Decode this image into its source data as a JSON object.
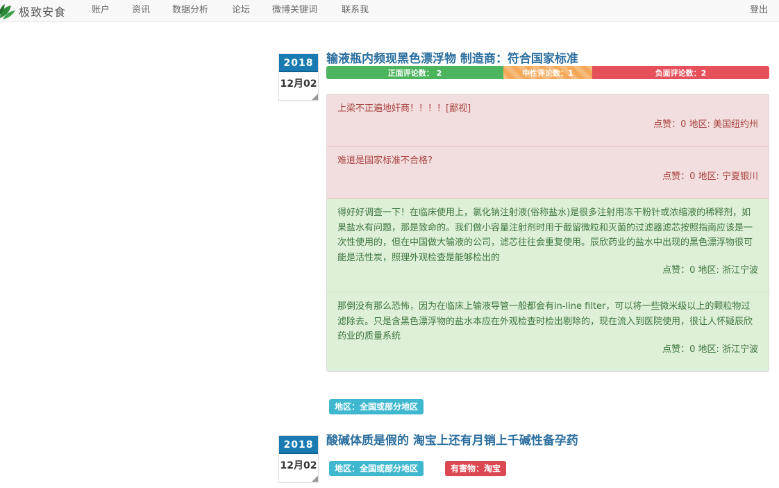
{
  "nav": {
    "brand": "极致安食",
    "items": [
      "账户",
      "资讯",
      "数据分析",
      "论坛",
      "微博关键词",
      "联系我"
    ],
    "logout": "登出"
  },
  "colors": {
    "positive": "#4cb45d",
    "neutral": "#f4a95a",
    "negative": "#e5505a",
    "info_label": "#3fb8cf",
    "danger_label": "#dc4852",
    "title": "#2a6e9e",
    "date_year_bg": "#1a7bb3"
  },
  "article1": {
    "year": "2018",
    "month_day": "12月02",
    "title": "输液瓶内频现黑色漂浮物 制造商：符合国家标准",
    "sentiment": {
      "positive": "正面评论数： 2",
      "neutral": "中性评论数：1",
      "negative": "负面评论数：2"
    },
    "comments": [
      {
        "type": "negative",
        "text": "上梁不正遍地奸商！！！！[鄙视]",
        "meta": "点赞：0 地区: 美国纽约州"
      },
      {
        "type": "negative",
        "text": "难道是国家标准不合格?",
        "meta": "点赞：0 地区: 宁夏银川"
      },
      {
        "type": "positive",
        "text": "得好好调查一下！在临床使用上，氯化钠注射液(俗称盐水)是很多注射用冻干粉针或浓缩液的稀释剂，如果盐水有问题，那是致命的。我们做小容量注射剂时用于截留微粒和灭菌的过滤器滤芯按照指南应该是一次性使用的，但在中国做大输液的公司，滤芯往往会重复使用。辰欣药业的盐水中出现的黑色漂浮物很可能是活性炭，照理外观检查是能够检出的",
        "meta": "点赞：0 地区: 浙江宁波"
      },
      {
        "type": "positive",
        "text": "那倒没有那么恐怖，因为在临床上输液导管一般都会有in-line filter，可以将一些微米级以上的颗粒物过滤除去。只是含黑色漂浮物的盐水本应在外观检查时检出剔除的，现在流入到医院使用，很让人怀疑辰欣药业的质量系统",
        "meta": "点赞：0 地区: 浙江宁波"
      }
    ]
  },
  "region_label_1": "地区：全国或部分地区",
  "article2": {
    "year": "2018",
    "month_day": "12月02",
    "title": "酸碱体质是假的 淘宝上还有月销上千碱性备孕药",
    "labels": {
      "region": "地区：全国或部分地区",
      "hazard": "有害物：淘宝"
    }
  }
}
